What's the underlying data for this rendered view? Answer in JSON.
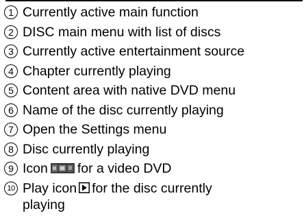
{
  "legend": {
    "items": [
      {
        "number": "1",
        "text": "Currently active main function"
      },
      {
        "number": "2",
        "text": "DISC main menu with list of discs"
      },
      {
        "number": "3",
        "text": "Currently active entertainment source"
      },
      {
        "number": "4",
        "text": "Chapter currently playing"
      },
      {
        "number": "5",
        "text": "Content area with native DVD menu"
      },
      {
        "number": "6",
        "text": "Name of the disc currently playing"
      },
      {
        "number": "7",
        "text": "Open the Settings menu"
      },
      {
        "number": "8",
        "text": "Disc currently playing"
      },
      {
        "number": "9",
        "text_before": "Icon",
        "text_after": "for a video DVD",
        "icon": "video-dvd-icon"
      },
      {
        "number": "10",
        "text_before": "Play icon",
        "text_after": "for the disc currently playing",
        "icon": "play-icon"
      }
    ]
  }
}
